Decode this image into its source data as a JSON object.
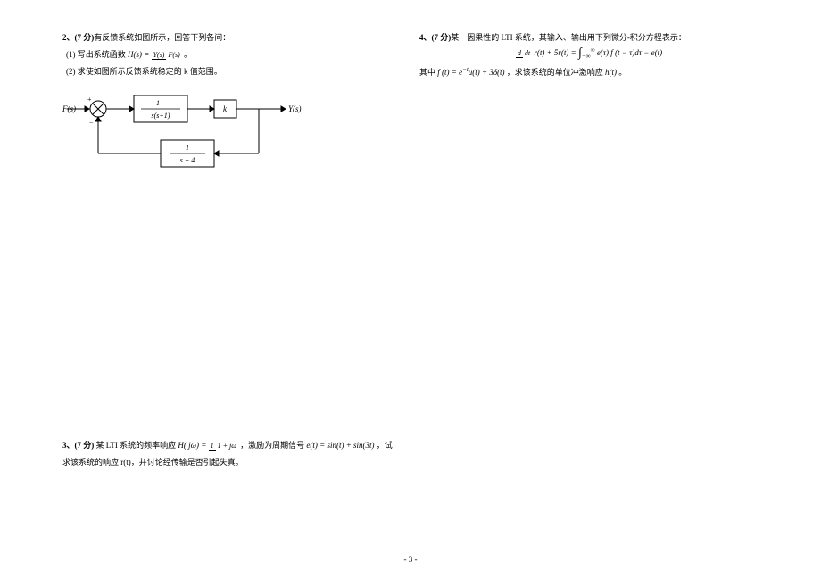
{
  "q2": {
    "header_prefix": "2、(7 分)",
    "header_text": "有反馈系统如图所示，回答下列各问：",
    "part1_label": "(1) 写出系统函数 ",
    "part1_eq_lead": "H(s) = ",
    "part1_frac_num": "Y(s)",
    "part1_frac_den": "F(s)",
    "part1_tail": " 。",
    "part2": "(2) 求使如图所示反馈系统稳定的 k 值范围。"
  },
  "diagram": {
    "input": "F(s)",
    "output": "Y(s)",
    "block1_num": "1",
    "block1_den": "s(s+1)",
    "block2": "k",
    "block3_num": "1",
    "block3_den": "s + 4",
    "sum_plus": "+",
    "sum_minus": "−"
  },
  "q3": {
    "header_prefix": "3、(7 分)",
    "line1_a": " 某 LTI 系统的频率响应 ",
    "line1_eq_lead": "H( jω) = ",
    "line1_frac_num": "1",
    "line1_frac_den": "1 + jω",
    "line1_b": " ，激励为周期信号 ",
    "line1_eq2": "e(t) = sin(t) + sin(3t)",
    "line1_c": " ，试",
    "line2": "求该系统的响应 r(t)，并讨论经传输是否引起失真。"
  },
  "q4": {
    "header_prefix": "4、(7 分)",
    "line1": "某一因果性的 LTI 系统，其输入、输出用下列微分-积分方程表示：",
    "eq_lhs_a": "d",
    "eq_lhs_b": "dt",
    "eq_lhs_c": " r(t) + 5r(t) = ",
    "eq_int": "∫",
    "eq_int_lo": "−∞",
    "eq_int_hi": "∞",
    "eq_rhs": " e(τ) f (t − τ)dτ − e(t)",
    "line2_a": "其中 ",
    "line2_eq": "f (t) = e",
    "line2_exp": "−t",
    "line2_eq2": "u(t) + 3δ(t)",
    "line2_b": " ，求该系统的单位冲激响应 ",
    "line2_eq3": "h(t)",
    "line2_c": " 。"
  },
  "pageno": "- 3 -"
}
